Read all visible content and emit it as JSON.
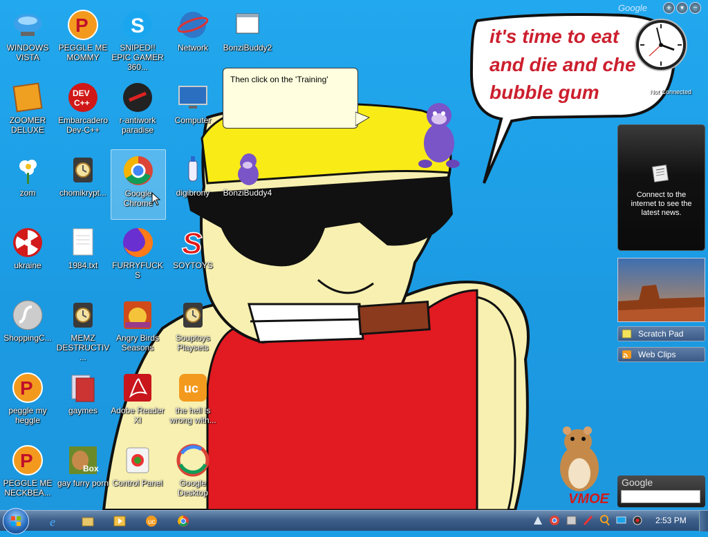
{
  "desktop": {
    "icons": [
      {
        "label": "WINDOWS VISTA",
        "icon": "vista-bowl-icon"
      },
      {
        "label": "PEGGLE ME MOMMY",
        "icon": "peggle-icon"
      },
      {
        "label": "SNIPED!! EPIC GAMER 360...",
        "icon": "skype-icon"
      },
      {
        "label": "Network",
        "icon": "network-globe-icon"
      },
      {
        "label": "BonziBuddy2",
        "icon": "folder-window-icon"
      },
      {
        "label": "ZOOMER DELUXE",
        "icon": "zoomer-game-icon"
      },
      {
        "label": "Embarcadero Dev-C++",
        "icon": "devcpp-icon"
      },
      {
        "label": "r-antiwork paradise",
        "icon": "antiwork-icon"
      },
      {
        "label": "Computer",
        "icon": "computer-monitor-icon"
      },
      {
        "label": "zom",
        "icon": "flower-icon"
      },
      {
        "label": "chomikrypt...",
        "icon": "app-clock-icon"
      },
      {
        "label": "Google Chrome",
        "icon": "chrome-icon"
      },
      {
        "label": "digibrony",
        "icon": "bottle-icon"
      },
      {
        "label": "BonziBuddy4",
        "icon": "bonzi-icon"
      },
      {
        "label": "ukraine",
        "icon": "radiation-icon"
      },
      {
        "label": "1984.txt",
        "icon": "text-file-icon"
      },
      {
        "label": "FURRYFUCKS",
        "icon": "firefox-icon"
      },
      {
        "label": "SOYTOYS",
        "icon": "soytoys-s-icon"
      },
      {
        "label": "ShoppingC...",
        "icon": "flash-icon"
      },
      {
        "label": "MEMZ DESTRUCTIV...",
        "icon": "app-clock-icon"
      },
      {
        "label": "Angry Birds Seasons",
        "icon": "angry-birds-icon"
      },
      {
        "label": "Souptoys Playsets",
        "icon": "app-clock-icon"
      },
      {
        "label": "peggle my heggle",
        "icon": "peggle-icon"
      },
      {
        "label": "gaymes",
        "icon": "media-folder-icon"
      },
      {
        "label": "Adobe Reader XI",
        "icon": "adobe-reader-icon"
      },
      {
        "label": "the hell is wrong with...",
        "icon": "uc-browser-icon"
      },
      {
        "label": "PEGGLE ME NECKBEA...",
        "icon": "peggle-icon"
      },
      {
        "label": "gay furry porn",
        "icon": "hamster-box-icon"
      },
      {
        "label": "Control Panel",
        "icon": "control-panel-icon"
      },
      {
        "label": "Google Desktop",
        "icon": "google-desktop-icon"
      }
    ],
    "callout_text": "Then click on the 'Training'",
    "wallpaper_speech": [
      "it's time to eat",
      "and die and che",
      "bubble gum"
    ],
    "wallpaper_watermark": "VMOE"
  },
  "sidebar": {
    "header_logo": "Google",
    "clock_status": "Not Connected",
    "news_message": "Connect to the internet to see the latest news.",
    "scratch_pad_label": "Scratch Pad",
    "web_clips_label": "Web Clips",
    "search_logo": "Google",
    "search_value": ""
  },
  "taskbar": {
    "quick_launch": [
      "internet-explorer-icon",
      "explorer-folder-icon",
      "media-player-icon",
      "uc-browser-icon",
      "chrome-icon"
    ],
    "tray": [
      "network-tray-icon",
      "chrome-tray-icon",
      "utility-tray-icon",
      "tools-tray-icon",
      "search-tray-icon",
      "display-tray-icon",
      "record-tray-icon"
    ],
    "time": "2:53 PM"
  },
  "colors": {
    "desktop_bg": "#1b9ae2",
    "taskbar": "#3d5f8a",
    "speech_text": "#cc1f2e"
  }
}
